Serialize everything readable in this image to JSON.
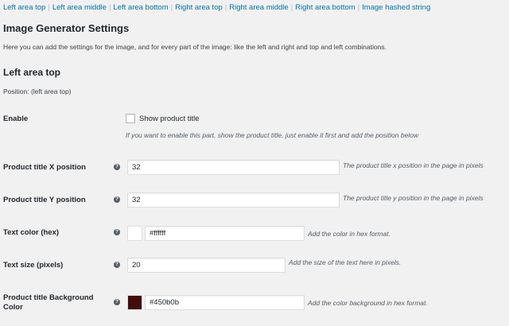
{
  "colors": {
    "accent": "#0073aa",
    "text_swatch": "#ffffff",
    "background_swatch": "#450b0b"
  },
  "subnav": {
    "items": [
      "Left area top",
      "Left area middle",
      "Left area bottom",
      "Right area top",
      "Right area middle",
      "Right area bottom",
      "Image hashed string"
    ],
    "separator": "|"
  },
  "page_title": "Image Generator Settings",
  "intro": "Here you can add the settings for the image, and for every part of the image: like the left and right and top and left combinations.",
  "section": {
    "title": "Left area top",
    "position_note": "Position: (left area top)"
  },
  "fields": {
    "enable": {
      "label": "Enable",
      "checkbox_label": "Show product title",
      "checked": false,
      "description": "If you want to enable this part, show the product title, just enable it first and add the position below"
    },
    "x_position": {
      "label": "Product title X position",
      "help_icon": "question-icon",
      "value": "32",
      "description": "The product title x position in the page in pixels"
    },
    "y_position": {
      "label": "Product title Y position",
      "help_icon": "question-icon",
      "value": "32",
      "description": "The product title y position in the page in pixels"
    },
    "text_color": {
      "label": "Text color (hex)",
      "help_icon": "question-icon",
      "value": "#ffffff",
      "description": "Add the color in hex format."
    },
    "text_size": {
      "label": "Text size (pixels)",
      "help_icon": "question-icon",
      "value": "20",
      "description": "Add the size of the text here in pixels."
    },
    "bg_color": {
      "label": "Product title Background Color",
      "help_icon": "question-icon",
      "value": "#450b0b",
      "description": "Add the color background in hex format."
    }
  }
}
